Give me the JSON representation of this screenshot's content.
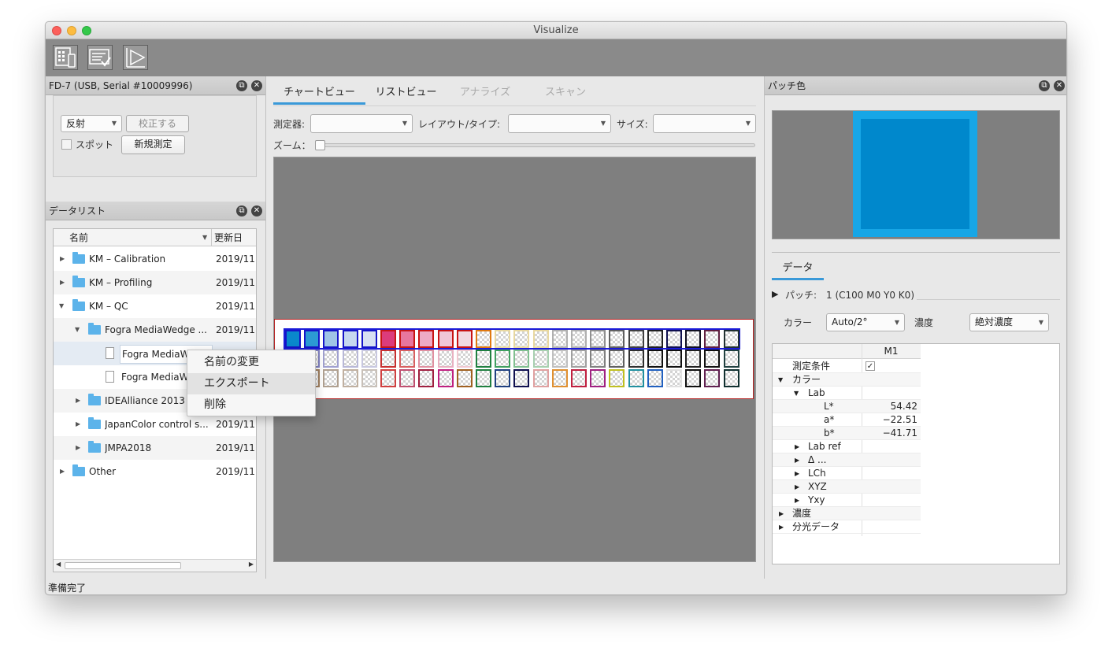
{
  "window": {
    "title": "Visualize"
  },
  "device_panel": {
    "title": "FD-7 (USB, Serial #10009996)",
    "mode_select": "反射",
    "calibrate_button": "校正する",
    "spot_label": "スポット",
    "new_measure_button": "新規測定"
  },
  "data_list": {
    "title": "データリスト",
    "col_name": "名前",
    "col_date": "更新日",
    "rows": [
      {
        "name": "KM – Calibration",
        "date": "2019/11"
      },
      {
        "name": "KM – Profiling",
        "date": "2019/11"
      },
      {
        "name": "KM – QC",
        "date": "2019/11"
      },
      {
        "name": "Fogra MediaWedge ...",
        "date": "2019/11"
      },
      {
        "name": "Fogra MediaWe",
        "date": ""
      },
      {
        "name": "Fogra MediaWe",
        "date": ""
      },
      {
        "name": "IDEAlliance 2013",
        "date": ""
      },
      {
        "name": "JapanColor control s...",
        "date": "2019/11"
      },
      {
        "name": "JMPA2018",
        "date": "2019/11"
      },
      {
        "name": "Other",
        "date": "2019/11"
      }
    ]
  },
  "context_menu": {
    "items": [
      "名前の変更",
      "エクスポート",
      "削除"
    ]
  },
  "center": {
    "tabs": [
      "チャートビュー",
      "リストビュー",
      "アナライズ",
      "スキャン"
    ],
    "instrument_label": "測定器:",
    "layout_label": "レイアウト/タイプ:",
    "size_label": "サイズ:",
    "zoom_label": "ズーム：",
    "zoom_level": 0
  },
  "patch_panel": {
    "title": "パッチ色",
    "data_tab": "データ",
    "patch_label": "パッチ:",
    "patch_value": "1 (C100 M0 Y0 K0)",
    "color_label": "カラー",
    "color_select": "Auto/2°",
    "density_label": "濃度",
    "density_select": "絶対濃度",
    "column_header": "M1",
    "patch_color": "#0088cc",
    "rows": [
      {
        "name": "測定条件",
        "value": "✓"
      },
      {
        "name": "カラー",
        "value": ""
      },
      {
        "name": "Lab",
        "value": ""
      },
      {
        "name": "L*",
        "value": "54.42"
      },
      {
        "name": "a*",
        "value": "−22.51"
      },
      {
        "name": "b*",
        "value": "−41.71"
      },
      {
        "name": "Lab ref",
        "value": ""
      },
      {
        "name": "Δ ...",
        "value": ""
      },
      {
        "name": "LCh",
        "value": ""
      },
      {
        "name": "XYZ",
        "value": ""
      },
      {
        "name": "Yxy",
        "value": ""
      },
      {
        "name": "濃度",
        "value": ""
      },
      {
        "name": "分光データ",
        "value": ""
      }
    ]
  },
  "status": {
    "text": "準備完了"
  },
  "colors": {
    "row1_fills": [
      "#0a88cc",
      "#2c9ad4",
      "#9fc5e6",
      "#c6d8ef",
      "#d7e0f2",
      "#dc3c7c",
      "#e8769e",
      "#eeaac4",
      "#f0c6d6",
      "#f1d9e2"
    ],
    "row1_borders": [
      "#1414c8",
      "#1414c8",
      "#1414c8",
      "#1414c8",
      "#1414c8",
      "#c81414",
      "#c81414",
      "#c81414",
      "#c81414",
      "#c81414",
      "#e07a10",
      "#e8d8a0",
      "#e8d8a0",
      "#e8d8a0",
      "#b0b0b0",
      "#b0b0b0",
      "#909090",
      "#606060",
      "#404040",
      "#202020",
      "#101050",
      "#101020",
      "#602040",
      "#203030"
    ],
    "row2_borders": [
      "#4040a8",
      "#8080c0",
      "#a0a0d0",
      "#b8b8d8",
      "#c8c8e0",
      "#c83030",
      "#d86060",
      "#e090a0",
      "#e8b0c0",
      "#f0c8d0",
      "#208040",
      "#40a060",
      "#80c090",
      "#a8d0b0",
      "#c0c0c0",
      "#a0a0a0",
      "#808080",
      "#606060",
      "#303030",
      "#101010",
      "#101010",
      "#202020",
      "#101010",
      "#204040"
    ],
    "row3_borders": [
      "#806040",
      "#a08060",
      "#b0a090",
      "#c0b0a0",
      "#c8c0b8",
      "#d04040",
      "#c05070",
      "#a02040",
      "#c02080",
      "#a06020",
      "#208040",
      "#204080",
      "#101050",
      "#e0a0a0",
      "#e09030",
      "#c02040",
      "#a02080",
      "#c0c020",
      "#2090a0",
      "#2060c0",
      "#e0e0e0",
      "#101010",
      "#602050",
      "#103030"
    ]
  }
}
